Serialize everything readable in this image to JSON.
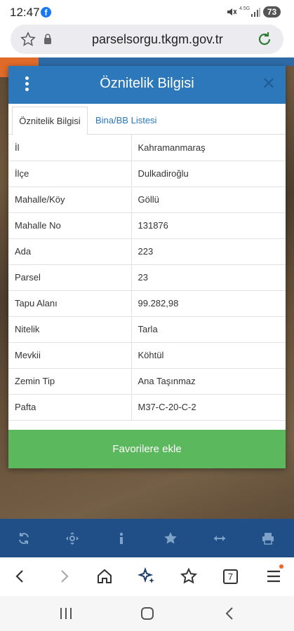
{
  "status_bar": {
    "time": "12:47",
    "network": "4.5G",
    "battery": "73"
  },
  "browser": {
    "url": "parselsorgu.tkgm.gov.tr",
    "open_tabs": "7"
  },
  "modal": {
    "title": "Öznitelik Bilgisi",
    "tabs": [
      {
        "label": "Öznitelik Bilgisi",
        "active": true
      },
      {
        "label": "Bina/BB Listesi",
        "active": false
      }
    ],
    "rows": [
      {
        "key": "İl",
        "value": "Kahramanmaraş"
      },
      {
        "key": "İlçe",
        "value": "Dulkadiroğlu"
      },
      {
        "key": "Mahalle/Köy",
        "value": "Göllü"
      },
      {
        "key": "Mahalle No",
        "value": "131876"
      },
      {
        "key": "Ada",
        "value": "223"
      },
      {
        "key": "Parsel",
        "value": "23"
      },
      {
        "key": "Tapu Alanı",
        "value": "99.282,98"
      },
      {
        "key": "Nitelik",
        "value": "Tarla"
      },
      {
        "key": "Mevkii",
        "value": "Köhtül"
      },
      {
        "key": "Zemin Tip",
        "value": "Ana Taşınmaz"
      },
      {
        "key": "Pafta",
        "value": "M37-C-20-C-2"
      }
    ],
    "favorite_button": "Favorilere ekle"
  },
  "colors": {
    "header_blue": "#2d78bb",
    "favorite_green": "#5cb85c",
    "toolbar_blue": "#1f4f86"
  }
}
